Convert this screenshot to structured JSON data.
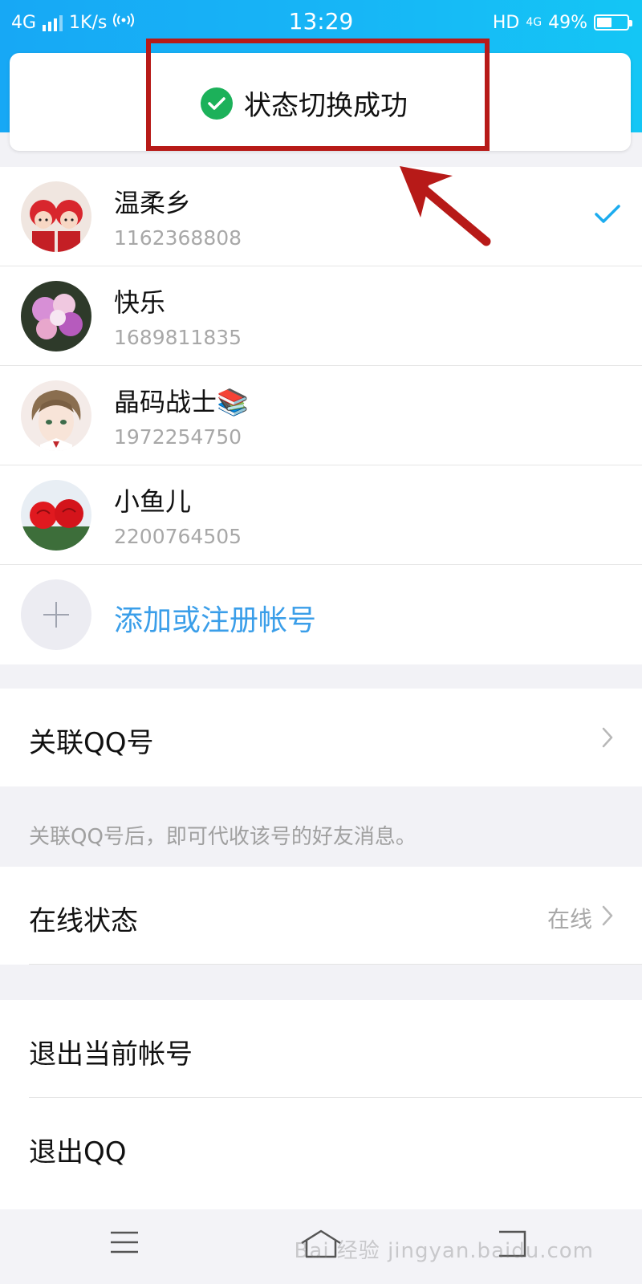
{
  "status_bar": {
    "network": "4G",
    "speed": "1K/s",
    "time": "13:29",
    "hd_label": "HD",
    "network_right": "4G",
    "battery": "49%",
    "battery_level": 0.49
  },
  "toast": {
    "message": "状态切换成功",
    "icon": "check-circle-icon"
  },
  "accounts": [
    {
      "name": "温柔乡",
      "qq": "1162368808",
      "selected": true,
      "avatar": "dolls-avatar"
    },
    {
      "name": "快乐",
      "qq": "1689811835",
      "selected": false,
      "avatar": "flowers-avatar"
    },
    {
      "name": "晶码战士📚",
      "qq": "1972254750",
      "selected": false,
      "avatar": "anime-boy-avatar"
    },
    {
      "name": "小鱼儿",
      "qq": "2200764505",
      "selected": false,
      "avatar": "roses-avatar"
    }
  ],
  "add_account": {
    "label": "添加或注册帐号"
  },
  "settings": {
    "link_qq": {
      "label": "关联QQ号"
    },
    "link_qq_note": "关联QQ号后，即可代收该号的好友消息。",
    "online_status": {
      "label": "在线状态",
      "value": "在线"
    },
    "logout_account": {
      "label": "退出当前帐号"
    },
    "exit_qq": {
      "label": "退出QQ"
    }
  },
  "watermark": "Bai 经验 jingyan.baidu.com",
  "colors": {
    "header_blue": "#17a8f5",
    "accent_blue": "#3a9ee9",
    "success_green": "#1cb15a",
    "annotation_red": "#b71a18"
  }
}
